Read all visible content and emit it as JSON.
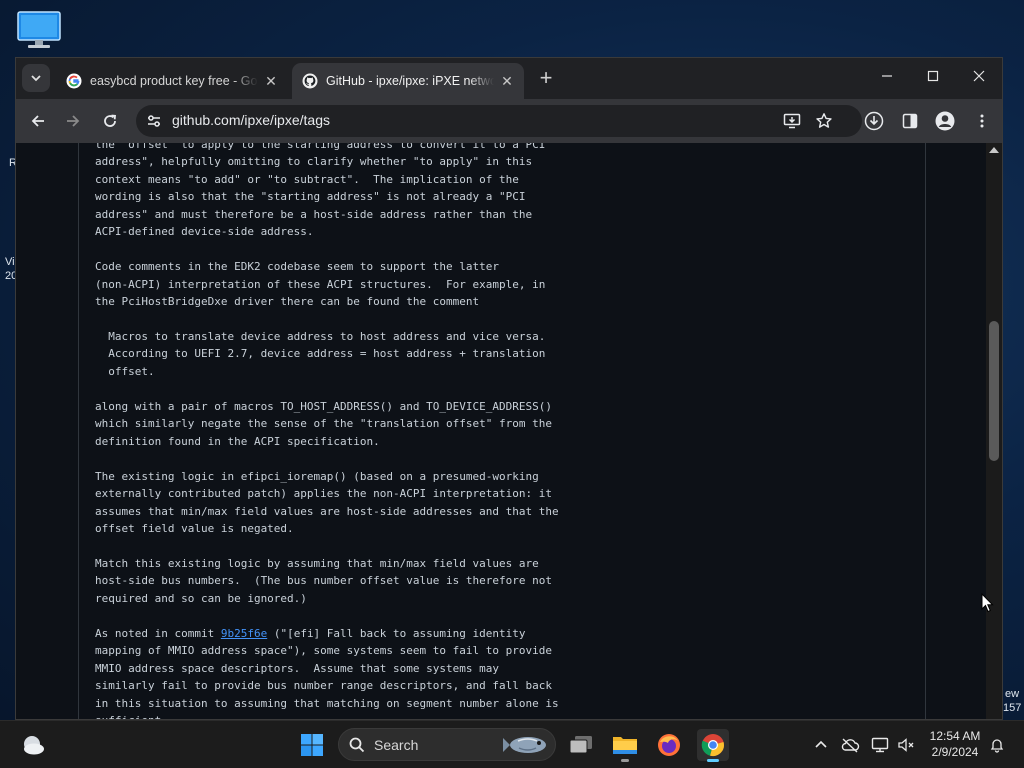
{
  "desktop": {
    "fragments": [
      {
        "text": "R"
      },
      {
        "text": "Vi"
      },
      {
        "text": "20"
      },
      {
        "text": "ew"
      },
      {
        "text": "157"
      }
    ]
  },
  "browser": {
    "tabs": [
      {
        "title": "easybcd product key free - Goo",
        "icon": "google-icon",
        "active": false
      },
      {
        "title": "GitHub - ipxe/ipxe: iPXE network",
        "icon": "github-icon",
        "active": true
      }
    ],
    "new_tab_label": "+",
    "url": "github.com/ipxe/ipxe/tags"
  },
  "content": {
    "pre_before_link": "the \"offset\" to apply to the starting address to convert it to a PCI\naddress\", helpfully omitting to clarify whether \"to apply\" in this\ncontext means \"to add\" or \"to subtract\".  The implication of the\nwording is also that the \"starting address\" is not already a \"PCI\naddress\" and must therefore be a host-side address rather than the\nACPI-defined device-side address.\n\nCode comments in the EDK2 codebase seem to support the latter\n(non-ACPI) interpretation of these ACPI structures.  For example, in\nthe PciHostBridgeDxe driver there can be found the comment\n\n  Macros to translate device address to host address and vice versa.\n  According to UEFI 2.7, device address = host address + translation\n  offset.\n\nalong with a pair of macros TO_HOST_ADDRESS() and TO_DEVICE_ADDRESS()\nwhich similarly negate the sense of the \"translation offset\" from the\ndefinition found in the ACPI specification.\n\nThe existing logic in efipci_ioremap() (based on a presumed-working\nexternally contributed patch) applies the non-ACPI interpretation: it\nassumes that min/max field values are host-side addresses and that the\noffset field value is negated.\n\nMatch this existing logic by assuming that min/max field values are\nhost-side bus numbers.  (The bus number offset value is therefore not\nrequired and so can be ignored.)\n\nAs noted in commit ",
    "commit_link": "9b25f6e",
    "pre_after_link": " (\"[efi] Fall back to assuming identity\nmapping of MMIO address space\"), some systems seem to fail to provide\nMMIO address space descriptors.  Assume that some systems may\nsimilarly fail to provide bus number range descriptors, and fall back\nin this situation to assuming that matching on segment number alone is\nsufficient."
  },
  "taskbar": {
    "search_label": "Search",
    "time": "12:54 AM",
    "date": "2/9/2024"
  },
  "colors": {
    "link": "#4493f8",
    "page_bg": "#0d1117",
    "tab_active": "#35363a"
  }
}
